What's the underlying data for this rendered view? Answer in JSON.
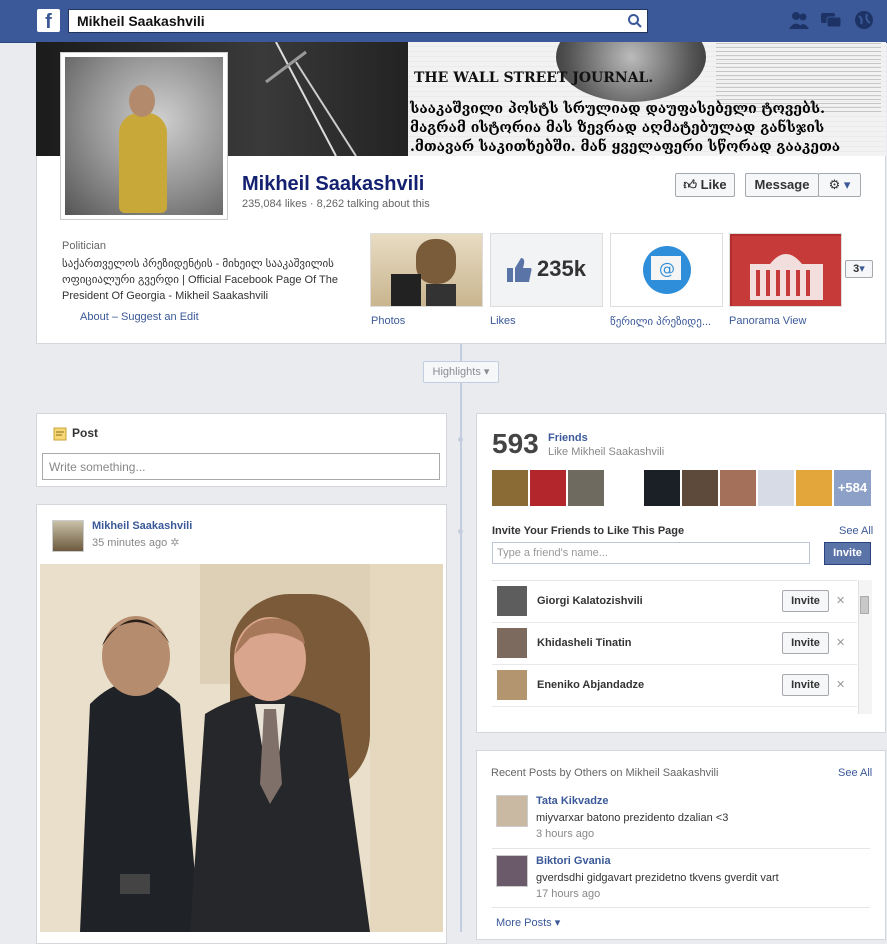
{
  "topbar": {
    "logo": "f",
    "search_value": "Mikheil Saakashvili"
  },
  "cover": {
    "newspaper": "THE WALL STREET JOURNAL.",
    "caption_line1": "სააკაშვილი პოსტს სრულიად დაუფასებელი ტოვებს.",
    "caption_line2": "მაგრამ ისტორია მას ზევრად აღმატებულად განსჯის",
    ".caption_line3": "",
    "caption_line3": ".მთავარ საკითხებში. მან ყველაფერი სწორად გააკეთა"
  },
  "page": {
    "name": "Mikheil Saakashvili",
    "stats": "235,084 likes · 8,262 talking about this",
    "like_label": "Like",
    "message_label": "Message",
    "category": "Politician",
    "description": "საქართველოს პრეზიდენტის - მიხეილ სააკაშვილის ოფიციალური გვერდი | Official Facebook Page Of The President Of Georgia - Mikheil Saakashvili",
    "about_link": "About",
    "suggest_link": "– Suggest an Edit"
  },
  "apps": [
    {
      "label": "Photos"
    },
    {
      "label": "Likes",
      "value": "235k"
    },
    {
      "label": "წერილი პრეზიდე..."
    },
    {
      "label": "Panorama View"
    }
  ],
  "apps_more": "3",
  "highlights": "Highlights",
  "composer": {
    "label": "Post",
    "placeholder": "Write something..."
  },
  "feed": {
    "author": "Mikheil Saakashvili",
    "time": "35 minutes ago"
  },
  "friends": {
    "count": "593",
    "label": "Friends",
    "sub": "Like Mikheil Saakashvili",
    "more": "+584",
    "invite_title": "Invite Your Friends to Like This Page",
    "see_all": "See All",
    "invite_placeholder": "Type a friend's name...",
    "invite_button": "Invite",
    "list": [
      {
        "name": "Giorgi Kalatozishvili",
        "button": "Invite"
      },
      {
        "name": "Khidasheli Tinatin",
        "button": "Invite"
      },
      {
        "name": "Eneniko Abjandadze",
        "button": "Invite"
      }
    ]
  },
  "recent": {
    "title": "Recent Posts by Others on Mikheil Saakashvili",
    "see_all": "See All",
    "posts": [
      {
        "name": "Tata Kikvadze",
        "text": "miyvarxar batono prezidento dzalian <3",
        "time": "3 hours ago"
      },
      {
        "name": "Biktori Gvania",
        "text": "gverdsdhi gidgavart prezidetno tkvens gverdit vart",
        "time": "17 hours ago"
      }
    ],
    "more": "More Posts"
  },
  "colors": {
    "brand": "#3b5998",
    "background": "#e9ebee",
    "link": "#3b5998"
  }
}
